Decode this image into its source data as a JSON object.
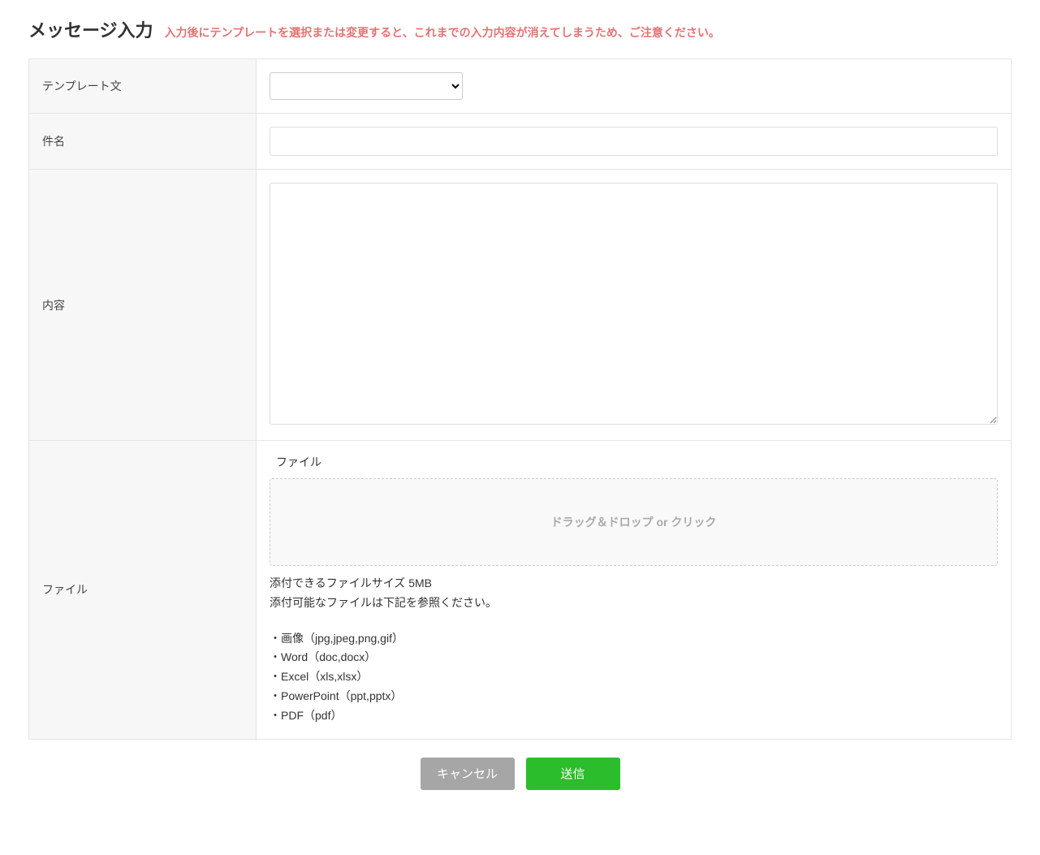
{
  "header": {
    "title": "メッセージ入力",
    "warning": "入力後にテンプレートを選択または変更すると、これまでの入力内容が消えてしまうため、ご注意ください。"
  },
  "form": {
    "template": {
      "label": "テンプレート文",
      "value": ""
    },
    "subject": {
      "label": "件名",
      "value": ""
    },
    "content": {
      "label": "内容",
      "value": ""
    },
    "file": {
      "label": "ファイル",
      "section_label": "ファイル",
      "dropzone_text": "ドラッグ＆ドロップ or クリック",
      "size_note": "添付できるファイルサイズ 5MB",
      "types_note": "添付可能なファイルは下記を参照ください。",
      "types": [
        "・画像（jpg,jpeg,png,gif）",
        "・Word（doc,docx）",
        "・Excel（xls,xlsx）",
        "・PowerPoint（ppt,pptx）",
        "・PDF（pdf）"
      ]
    }
  },
  "buttons": {
    "cancel": "キャンセル",
    "submit": "送信"
  }
}
